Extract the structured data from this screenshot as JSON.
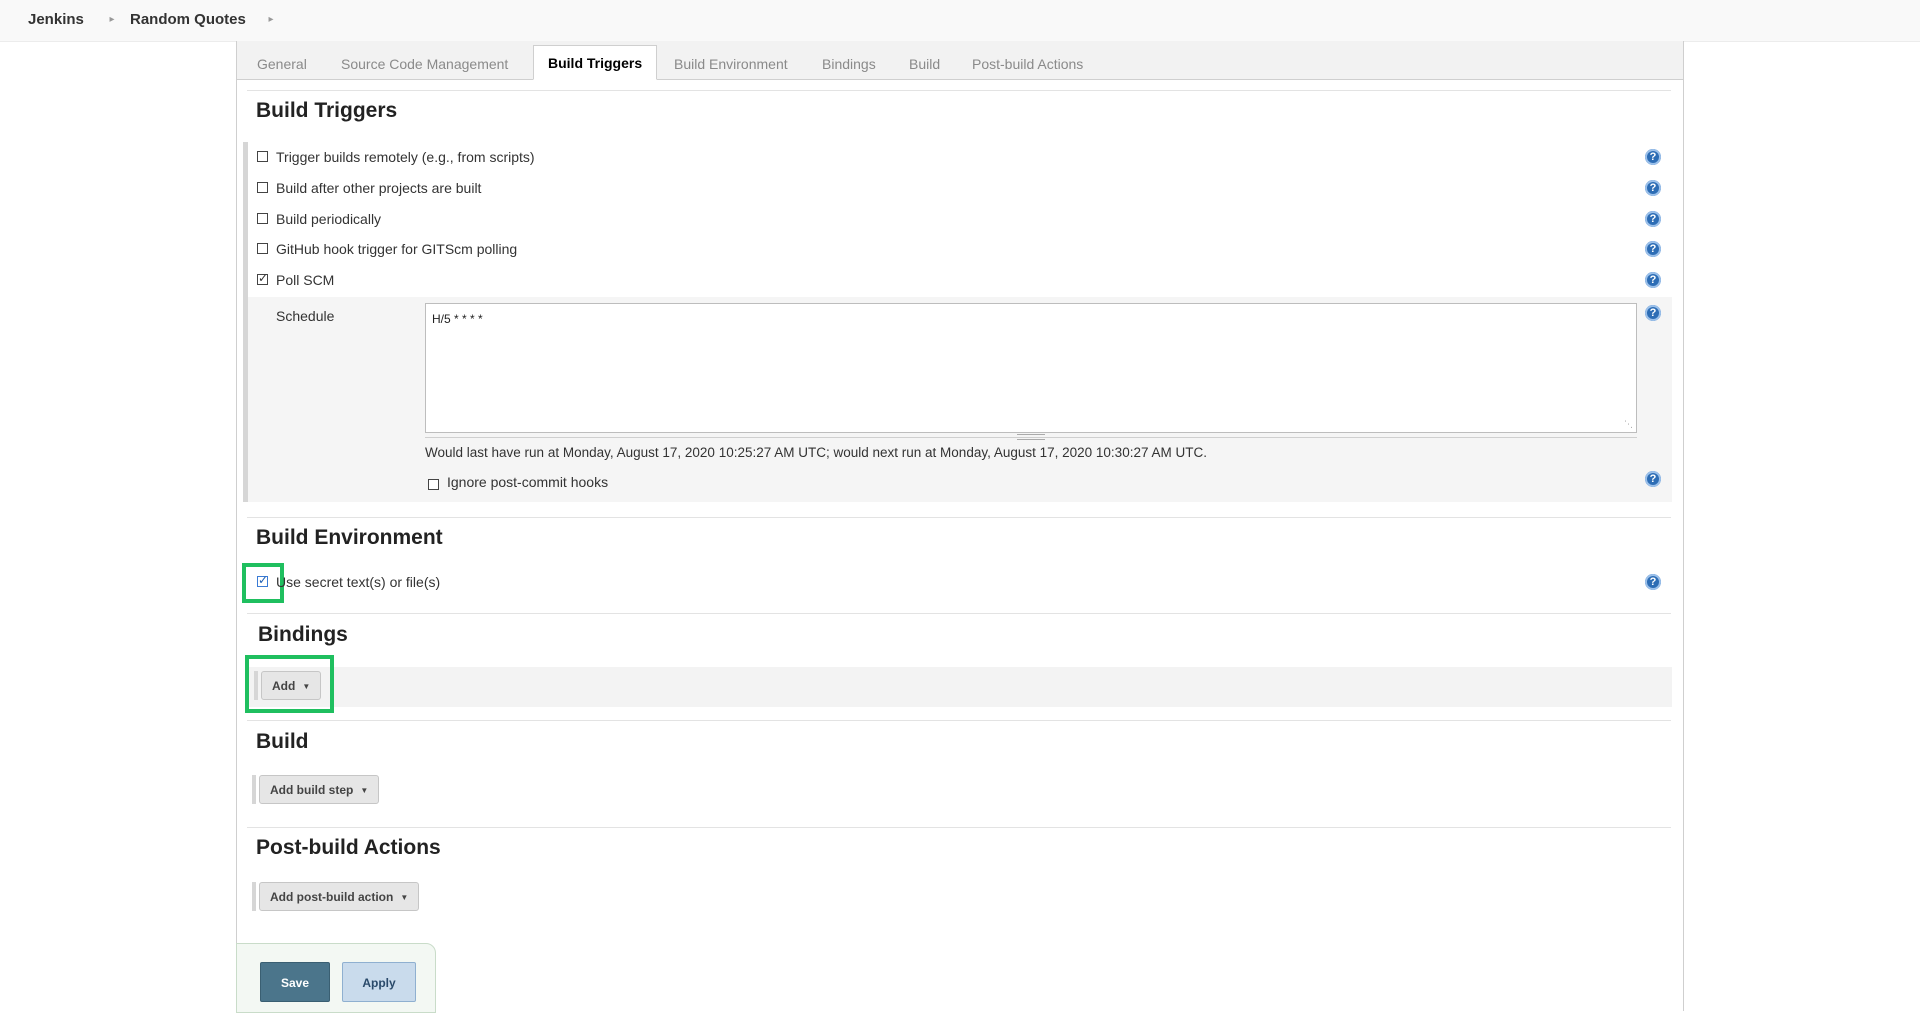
{
  "breadcrumb": {
    "items": [
      "Jenkins",
      "Random Quotes"
    ]
  },
  "tabs": [
    {
      "label": "General"
    },
    {
      "label": "Source Code Management"
    },
    {
      "label": "Build Triggers",
      "active": true
    },
    {
      "label": "Build Environment"
    },
    {
      "label": "Bindings"
    },
    {
      "label": "Build"
    },
    {
      "label": "Post-build Actions"
    }
  ],
  "build_triggers": {
    "title": "Build Triggers",
    "options": [
      {
        "label": "Trigger builds remotely (e.g., from scripts)",
        "checked": false
      },
      {
        "label": "Build after other projects are built",
        "checked": false
      },
      {
        "label": "Build periodically",
        "checked": false
      },
      {
        "label": "GitHub hook trigger for GITScm polling",
        "checked": false
      },
      {
        "label": "Poll SCM",
        "checked": true
      }
    ],
    "schedule_label": "Schedule",
    "schedule_value": "H/5 * * * *",
    "schedule_info": "Would last have run at Monday, August 17, 2020 10:25:27 AM UTC; would next run at Monday, August 17, 2020 10:30:27 AM UTC.",
    "ignore_hooks_label": "Ignore post-commit hooks",
    "ignore_hooks_checked": false
  },
  "build_environment": {
    "title": "Build Environment",
    "use_secret_label": "Use secret text(s) or file(s)",
    "use_secret_checked": true
  },
  "bindings": {
    "title": "Bindings",
    "add_label": "Add"
  },
  "build": {
    "title": "Build",
    "add_step_label": "Add build step"
  },
  "post_build": {
    "title": "Post-build Actions",
    "add_action_label": "Add post-build action"
  },
  "footer": {
    "save_label": "Save",
    "apply_label": "Apply"
  },
  "help_icon_glyph": "?",
  "colors": {
    "highlight": "#1fbf5f",
    "save_button": "#4b758b",
    "apply_button": "#c9dbec",
    "help_icon": "#2d6db5"
  }
}
